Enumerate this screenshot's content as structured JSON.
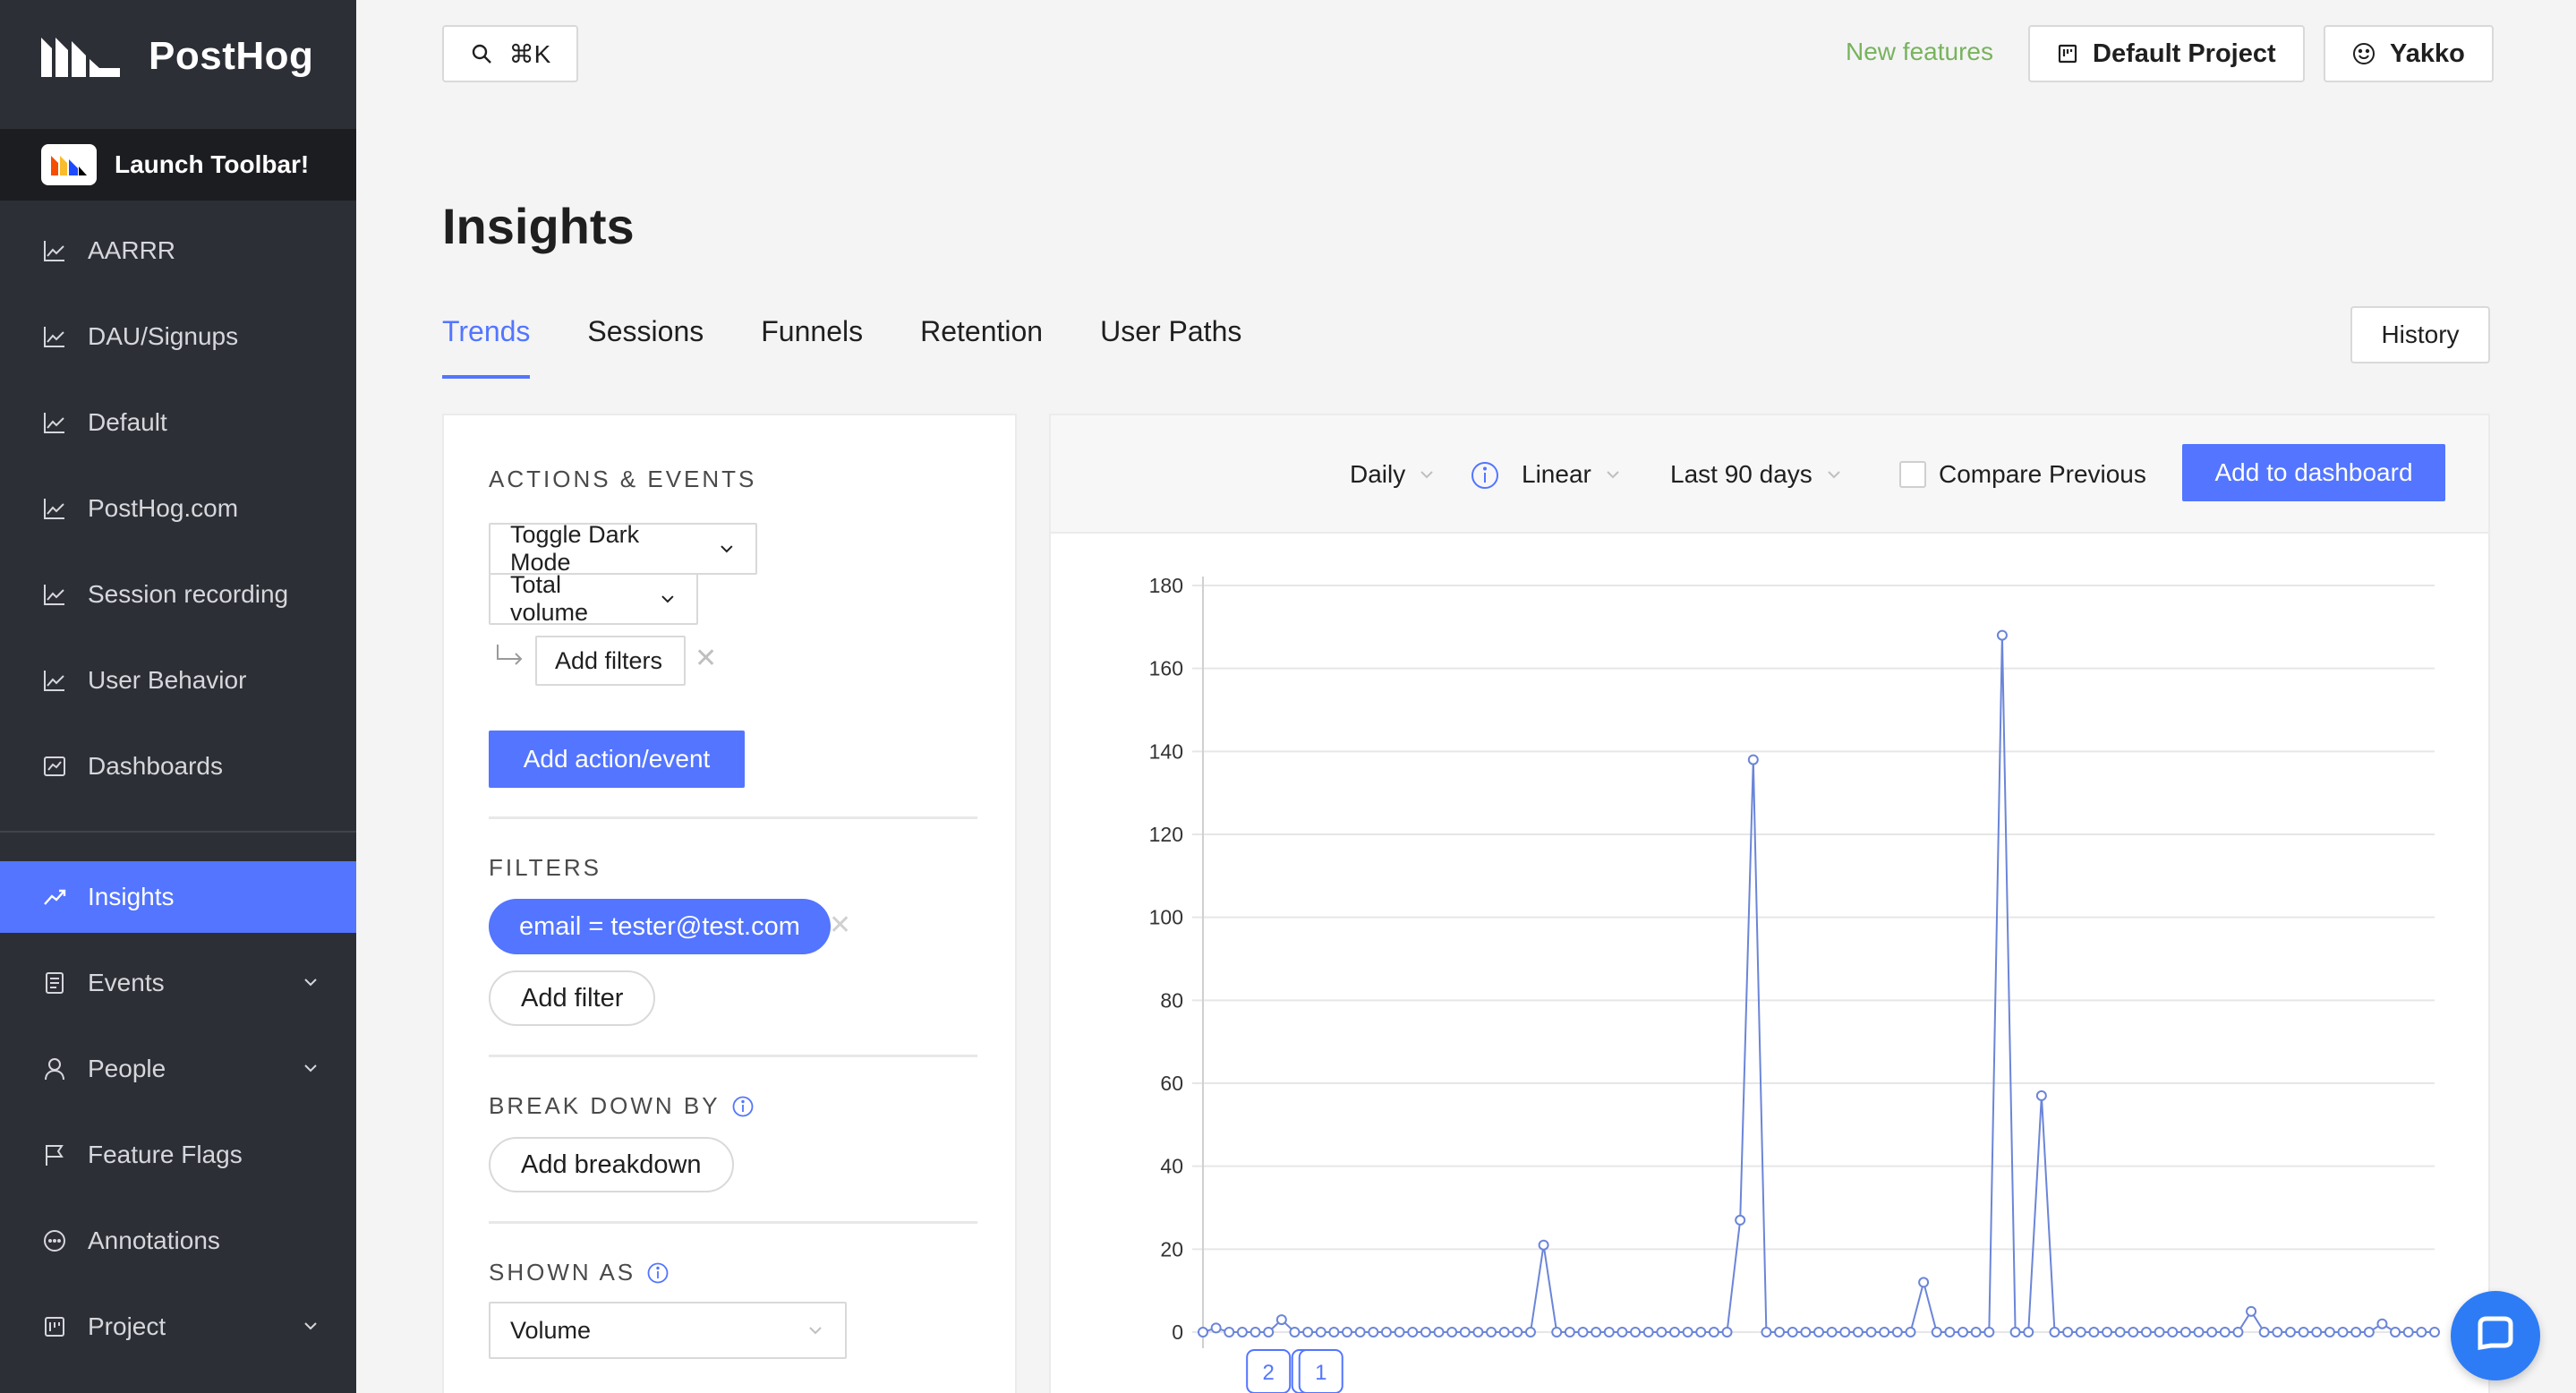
{
  "app": {
    "name": "PostHog",
    "launch_toolbar": "Launch Toolbar!"
  },
  "sidebar": {
    "items": [
      {
        "label": "AARRR",
        "icon": "line-chart-icon"
      },
      {
        "label": "DAU/Signups",
        "icon": "line-chart-icon"
      },
      {
        "label": "Default",
        "icon": "line-chart-icon"
      },
      {
        "label": "PostHog.com",
        "icon": "line-chart-icon"
      },
      {
        "label": "Session recording",
        "icon": "line-chart-icon"
      },
      {
        "label": "User Behavior",
        "icon": "line-chart-icon"
      },
      {
        "label": "Dashboards",
        "icon": "dashboard-icon"
      },
      {
        "label": "Insights",
        "icon": "rise-icon",
        "active": true
      },
      {
        "label": "Events",
        "icon": "document-icon",
        "expandable": true
      },
      {
        "label": "People",
        "icon": "user-icon",
        "expandable": true
      },
      {
        "label": "Feature Flags",
        "icon": "flag-icon"
      },
      {
        "label": "Annotations",
        "icon": "message-icon"
      },
      {
        "label": "Project",
        "icon": "project-icon",
        "expandable": true
      }
    ]
  },
  "topbar": {
    "search_shortcut": "⌘K",
    "new_features": "New features",
    "project": "Default Project",
    "user": "Yakko"
  },
  "page": {
    "title": "Insights",
    "tabs": [
      "Trends",
      "Sessions",
      "Funnels",
      "Retention",
      "User Paths"
    ],
    "active_tab": "Trends",
    "history": "History"
  },
  "query": {
    "actions_events_label": "ACTIONS & EVENTS",
    "event": "Toggle Dark Mode",
    "math": "Total volume",
    "add_filters": "Add filters",
    "add_action_event": "Add action/event",
    "filters_label": "FILTERS",
    "filter_pill": "email = tester@test.com",
    "add_filter": "Add filter",
    "breakdown_label": "BREAK DOWN BY",
    "add_breakdown": "Add breakdown",
    "shown_as_label": "SHOWN AS",
    "shown_as": "Volume"
  },
  "chart_controls": {
    "interval": "Daily",
    "scale": "Linear",
    "date_range": "Last 90 days",
    "compare_previous": "Compare Previous",
    "compare_checked": false,
    "add_to_dashboard": "Add to dashboard"
  },
  "colors": {
    "accent": "#5375ff",
    "sidebar_bg": "#2d2f36",
    "line": "#6b85d8",
    "new_features": "#78b35c"
  },
  "annotation_markers": [
    "2",
    "1"
  ],
  "chart_data": {
    "type": "line",
    "ylim": [
      0,
      180
    ],
    "yticks": [
      0,
      20,
      40,
      60,
      80,
      100,
      120,
      140,
      160,
      180
    ],
    "grid": true,
    "series": [
      {
        "values": [
          0,
          1,
          0,
          0,
          0,
          0,
          3,
          0,
          0,
          0,
          0,
          0,
          0,
          0,
          0,
          0,
          0,
          0,
          0,
          0,
          0,
          0,
          0,
          0,
          0,
          0,
          21,
          0,
          0,
          0,
          0,
          0,
          0,
          0,
          0,
          0,
          0,
          0,
          0,
          0,
          0,
          27,
          138,
          0,
          0,
          0,
          0,
          0,
          0,
          0,
          0,
          0,
          0,
          0,
          0,
          12,
          0,
          0,
          0,
          0,
          0,
          168,
          0,
          0,
          57,
          0,
          0,
          0,
          0,
          0,
          0,
          0,
          0,
          0,
          0,
          0,
          0,
          0,
          0,
          0,
          5,
          0,
          0,
          0,
          0,
          0,
          0,
          0,
          0,
          0,
          2,
          0,
          0,
          0,
          0
        ]
      }
    ]
  }
}
